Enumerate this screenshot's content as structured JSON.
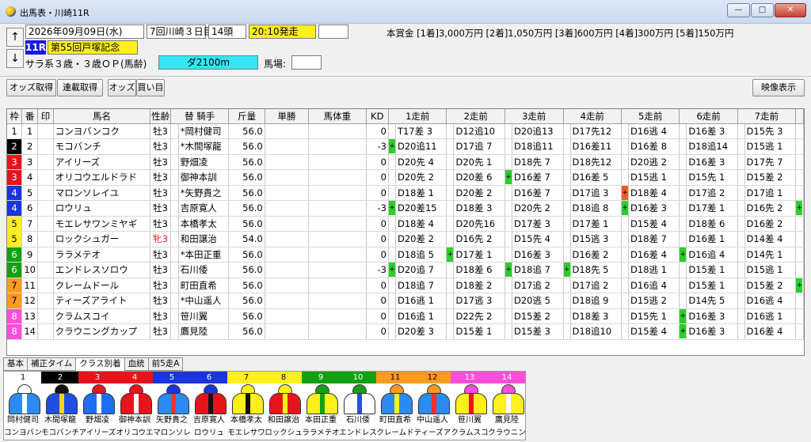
{
  "window": {
    "title": "出馬表・川崎11R"
  },
  "race": {
    "date": "2026年09月09日(水)",
    "meeting": "7回川崎３日目",
    "runners": "14頭",
    "post_time": "20:10発走",
    "post_extra": "",
    "number": "11R",
    "name": "第55回戸塚記念",
    "conditions": "サラ系３歳・３歳ＯＰ(馬齢)",
    "course": "ダ2100m",
    "baba_label": "馬場:",
    "baba_value": "",
    "prize": "本賞金 [1着]3,000万円 [2着]1,050万円 [3着]600万円 [4着]300万円 [5着]150万円"
  },
  "nav": {
    "up": "↑",
    "down": "↓"
  },
  "toolbar": {
    "odds": "オッズ取得",
    "renpuku": "連載取得",
    "odds2": "オッズ",
    "kaime": "買い目",
    "video": "映像表示"
  },
  "columns": [
    "枠",
    "番",
    "印",
    "馬名",
    "性齢",
    "替",
    "騎手",
    "斤量",
    "単勝",
    "馬体重",
    "KD",
    "1走前",
    "2走前",
    "3走前",
    "4走前",
    "5走前",
    "6走前",
    "7走前"
  ],
  "frame_colors": {
    "1": {
      "bg": "#ffffff",
      "fg": "#000000"
    },
    "2": {
      "bg": "#000000",
      "fg": "#ffffff"
    },
    "3": {
      "bg": "#e8141c",
      "fg": "#ffffff"
    },
    "4": {
      "bg": "#1a35e0",
      "fg": "#ffffff"
    },
    "5": {
      "bg": "#ffef1a",
      "fg": "#000000"
    },
    "6": {
      "bg": "#13a013",
      "fg": "#ffffff"
    },
    "7": {
      "bg": "#ff9a1e",
      "fg": "#000000"
    },
    "8": {
      "bg": "#ff4fd8",
      "fg": "#ffffff"
    }
  },
  "horses": [
    {
      "waku": "1",
      "uma": "1",
      "mark": "",
      "name": "コンヨバンコク",
      "sex": "牡3",
      "sex_color": "",
      "kae": "",
      "jockey": "*岡村健司",
      "kin": "56.0",
      "odds": "",
      "weight": "",
      "kd": "0",
      "runs": [
        [
          "",
          "T17差 3"
        ],
        [
          "",
          "D12追10"
        ],
        [
          "",
          "D20追13"
        ],
        [
          "",
          "D17先12"
        ],
        [
          "",
          "D16逃 4"
        ],
        [
          "",
          "D16差 3"
        ],
        [
          "",
          "D15先 3"
        ]
      ],
      "tail": ""
    },
    {
      "waku": "2",
      "uma": "2",
      "mark": "",
      "name": "モコバンチ",
      "sex": "牡3",
      "sex_color": "",
      "kae": "",
      "jockey": "*木間塚龍",
      "kin": "56.0",
      "odds": "",
      "weight": "",
      "kd": "-3",
      "runs": [
        [
          "g",
          "D20追11"
        ],
        [
          "",
          "D17追 7"
        ],
        [
          "",
          "D18追11"
        ],
        [
          "",
          "D16差11"
        ],
        [
          "",
          "D16差 8"
        ],
        [
          "",
          "D18追14"
        ],
        [
          "",
          "D15逃 1"
        ]
      ],
      "tail": ""
    },
    {
      "waku": "3",
      "uma": "3",
      "mark": "",
      "name": "アイリーズ",
      "sex": "牡3",
      "sex_color": "",
      "kae": "",
      "jockey": "野畑凌",
      "kin": "56.0",
      "odds": "",
      "weight": "",
      "kd": "0",
      "runs": [
        [
          "",
          "D20先 4"
        ],
        [
          "",
          "D20先 1"
        ],
        [
          "",
          "D18先 7"
        ],
        [
          "",
          "D18先12"
        ],
        [
          "",
          "D20逃 2"
        ],
        [
          "",
          "D16差 3"
        ],
        [
          "",
          "D17先 7"
        ]
      ],
      "tail": ""
    },
    {
      "waku": "3",
      "uma": "4",
      "mark": "",
      "name": "オリコウエルドラド",
      "sex": "牡3",
      "sex_color": "",
      "kae": "",
      "jockey": "御神本訓",
      "kin": "56.0",
      "odds": "",
      "weight": "",
      "kd": "0",
      "runs": [
        [
          "",
          "D20先 2"
        ],
        [
          "",
          "D20差 6"
        ],
        [
          "g",
          "D16差 7"
        ],
        [
          "",
          "D16差 5"
        ],
        [
          "",
          "D15逃 1"
        ],
        [
          "",
          "D15先 1"
        ],
        [
          "",
          "D15差 2"
        ]
      ],
      "tail": ""
    },
    {
      "waku": "4",
      "uma": "5",
      "mark": "",
      "name": "マロンソレイユ",
      "sex": "牡3",
      "sex_color": "",
      "kae": "",
      "jockey": "*矢野貴之",
      "kin": "56.0",
      "odds": "",
      "weight": "",
      "kd": "0",
      "runs": [
        [
          "",
          "D18差 1"
        ],
        [
          "",
          "D20差 2"
        ],
        [
          "",
          "D16差 7"
        ],
        [
          "",
          "D17追 3"
        ],
        [
          "o",
          "D18差 4"
        ],
        [
          "",
          "D17追 2"
        ],
        [
          "",
          "D17追 1"
        ]
      ],
      "tail": ""
    },
    {
      "waku": "4",
      "uma": "6",
      "mark": "",
      "name": "ロウリュ",
      "sex": "牡3",
      "sex_color": "",
      "kae": "",
      "jockey": "吉原寛人",
      "kin": "56.0",
      "odds": "",
      "weight": "",
      "kd": "-3",
      "runs": [
        [
          "g",
          "D20差15"
        ],
        [
          "",
          "D18差 3"
        ],
        [
          "",
          "D20先 2"
        ],
        [
          "",
          "D18追 8"
        ],
        [
          "g",
          "D16差 3"
        ],
        [
          "",
          "D17差 1"
        ],
        [
          "",
          "D16先 2"
        ]
      ],
      "tail": "g"
    },
    {
      "waku": "5",
      "uma": "7",
      "mark": "",
      "name": "モエレサワンミヤギ",
      "sex": "牡3",
      "sex_color": "",
      "kae": "",
      "jockey": "本橋孝太",
      "kin": "56.0",
      "odds": "",
      "weight": "",
      "kd": "0",
      "runs": [
        [
          "",
          "D18差 4"
        ],
        [
          "",
          "D20先16"
        ],
        [
          "",
          "D17差 3"
        ],
        [
          "",
          "D17差 1"
        ],
        [
          "",
          "D15差 4"
        ],
        [
          "",
          "D18差 6"
        ],
        [
          "",
          "D16差 2"
        ]
      ],
      "tail": ""
    },
    {
      "waku": "5",
      "uma": "8",
      "mark": "",
      "name": "ロックシュガー",
      "sex": "牝3",
      "sex_color": "#e8141c",
      "kae": "",
      "jockey": "和田譲治",
      "kin": "54.0",
      "odds": "",
      "weight": "",
      "kd": "0",
      "runs": [
        [
          "",
          "D20差 2"
        ],
        [
          "",
          "D16先 2"
        ],
        [
          "",
          "D15先 4"
        ],
        [
          "",
          "D15逃 3"
        ],
        [
          "",
          "D18差 7"
        ],
        [
          "",
          "D16差 1"
        ],
        [
          "",
          "D14差 4"
        ]
      ],
      "tail": ""
    },
    {
      "waku": "6",
      "uma": "9",
      "mark": "",
      "name": "ララメテオ",
      "sex": "牡3",
      "sex_color": "",
      "kae": "",
      "jockey": "*本田正重",
      "kin": "56.0",
      "odds": "",
      "weight": "",
      "kd": "0",
      "runs": [
        [
          "",
          "D18追 5"
        ],
        [
          "g",
          "D17差 1"
        ],
        [
          "",
          "D16差 3"
        ],
        [
          "",
          "D16差 2"
        ],
        [
          "",
          "D16差 4"
        ],
        [
          "g",
          "D16追 4"
        ],
        [
          "",
          "D14先 1"
        ]
      ],
      "tail": ""
    },
    {
      "waku": "6",
      "uma": "10",
      "mark": "",
      "name": "エンドレスソロウ",
      "sex": "牡3",
      "sex_color": "",
      "kae": "",
      "jockey": "石川倭",
      "kin": "56.0",
      "odds": "",
      "weight": "",
      "kd": "-3",
      "runs": [
        [
          "g",
          "D20追 7"
        ],
        [
          "",
          "D18差 6"
        ],
        [
          "g",
          "D18追 7"
        ],
        [
          "g",
          "D18先 5"
        ],
        [
          "",
          "D18逃 1"
        ],
        [
          "",
          "D15差 1"
        ],
        [
          "",
          "D15逃 1"
        ]
      ],
      "tail": ""
    },
    {
      "waku": "7",
      "uma": "11",
      "mark": "",
      "name": "クレームドール",
      "sex": "牡3",
      "sex_color": "",
      "kae": "",
      "jockey": "町田直希",
      "kin": "56.0",
      "odds": "",
      "weight": "",
      "kd": "0",
      "runs": [
        [
          "",
          "D18追 7"
        ],
        [
          "",
          "D18差 2"
        ],
        [
          "",
          "D17追 2"
        ],
        [
          "",
          "D17追 2"
        ],
        [
          "",
          "D16追 4"
        ],
        [
          "",
          "D15差 1"
        ],
        [
          "",
          "D15差 2"
        ]
      ],
      "tail": "g"
    },
    {
      "waku": "7",
      "uma": "12",
      "mark": "",
      "name": "ティーズアライト",
      "sex": "牡3",
      "sex_color": "",
      "kae": "",
      "jockey": "*中山遥人",
      "kin": "56.0",
      "odds": "",
      "weight": "",
      "kd": "0",
      "runs": [
        [
          "",
          "D16逃 1"
        ],
        [
          "",
          "D17逃 3"
        ],
        [
          "",
          "D20逃 5"
        ],
        [
          "",
          "D18追 9"
        ],
        [
          "",
          "D15逃 2"
        ],
        [
          "",
          "D14先 5"
        ],
        [
          "",
          "D16逃 4"
        ]
      ],
      "tail": ""
    },
    {
      "waku": "8",
      "uma": "13",
      "mark": "",
      "name": "クラムスコイ",
      "sex": "牡3",
      "sex_color": "",
      "kae": "",
      "jockey": "笹川翼",
      "kin": "56.0",
      "odds": "",
      "weight": "",
      "kd": "0",
      "runs": [
        [
          "",
          "D16追 1"
        ],
        [
          "",
          "D22先 2"
        ],
        [
          "",
          "D15差 2"
        ],
        [
          "",
          "D18差 3"
        ],
        [
          "",
          "D15先 1"
        ],
        [
          "g",
          "D16差 3"
        ],
        [
          "",
          "D16逃 1"
        ]
      ],
      "tail": ""
    },
    {
      "waku": "8",
      "uma": "14",
      "mark": "",
      "name": "クラウニングカップ",
      "sex": "牡3",
      "sex_color": "",
      "kae": "",
      "jockey": "鷹見陸",
      "kin": "56.0",
      "odds": "",
      "weight": "",
      "kd": "0",
      "runs": [
        [
          "",
          "D20差 3"
        ],
        [
          "",
          "D15差 1"
        ],
        [
          "",
          "D15差 3"
        ],
        [
          "",
          "D18追10"
        ],
        [
          "",
          "D15差 4"
        ],
        [
          "g",
          "D16差 3"
        ],
        [
          "",
          "D16差 4"
        ]
      ],
      "tail": ""
    }
  ],
  "tabs": [
    "基本",
    "補正タイム",
    "クラス別着",
    "血統",
    "前5走A"
  ],
  "active_tab": "クラス別着",
  "silks": [
    {
      "num": "1",
      "jockey": "岡村健司",
      "horse": "コンヨバン",
      "helm": "#ffffff",
      "body": "#2b8bf0",
      "pattern": "#ffffff"
    },
    {
      "num": "2",
      "jockey": "木間塚龍",
      "horse": "モコバンチ",
      "helm": "#111111",
      "body": "#1e4fe0",
      "pattern": "#ffd21a"
    },
    {
      "num": "3",
      "jockey": "野畑凌",
      "horse": "アイリーズ",
      "helm": "#e8141c",
      "body": "#1e6ff0",
      "pattern": "#ffffff"
    },
    {
      "num": "4",
      "jockey": "御神本訓",
      "horse": "オリコウエ",
      "helm": "#e8141c",
      "body": "#e8141c",
      "pattern": "#ffffff"
    },
    {
      "num": "5",
      "jockey": "矢野貴之",
      "horse": "マロンソレ",
      "helm": "#1a35e0",
      "body": "#2b8bf0",
      "pattern": "#ff3030"
    },
    {
      "num": "6",
      "jockey": "吉原寛人",
      "horse": "ロウリュ",
      "helm": "#1a35e0",
      "body": "#e8141c",
      "pattern": "#111111"
    },
    {
      "num": "7",
      "jockey": "本橋孝太",
      "horse": "モエレサワ",
      "helm": "#ffef1a",
      "body": "#ffef1a",
      "pattern": "#111111"
    },
    {
      "num": "8",
      "jockey": "和田譲治",
      "horse": "ロックシュ",
      "helm": "#ffef1a",
      "body": "#e8141c",
      "pattern": "#ffef1a"
    },
    {
      "num": "9",
      "jockey": "本田正重",
      "horse": "ララメテオ",
      "helm": "#13a013",
      "body": "#ffef1a",
      "pattern": "#13a013"
    },
    {
      "num": "10",
      "jockey": "石川倭",
      "horse": "エンドレス",
      "helm": "#13a013",
      "body": "#ffffff",
      "pattern": "#2a4fd8"
    },
    {
      "num": "11",
      "jockey": "町田直希",
      "horse": "クレームド",
      "helm": "#ff9a1e",
      "body": "#2b8bf0",
      "pattern": "#ffef1a"
    },
    {
      "num": "12",
      "jockey": "中山遥人",
      "horse": "ティーズア",
      "helm": "#ff9a1e",
      "body": "#2b8bf0",
      "pattern": "#ff3030"
    },
    {
      "num": "13",
      "jockey": "笹川翼",
      "horse": "クラムスコ",
      "helm": "#ff4fd8",
      "body": "#ffef1a",
      "pattern": "#e8141c"
    },
    {
      "num": "14",
      "jockey": "鷹見陸",
      "horse": "クラウニン",
      "helm": "#ff4fd8",
      "body": "#ffef1a",
      "pattern": "#ffffff"
    }
  ]
}
